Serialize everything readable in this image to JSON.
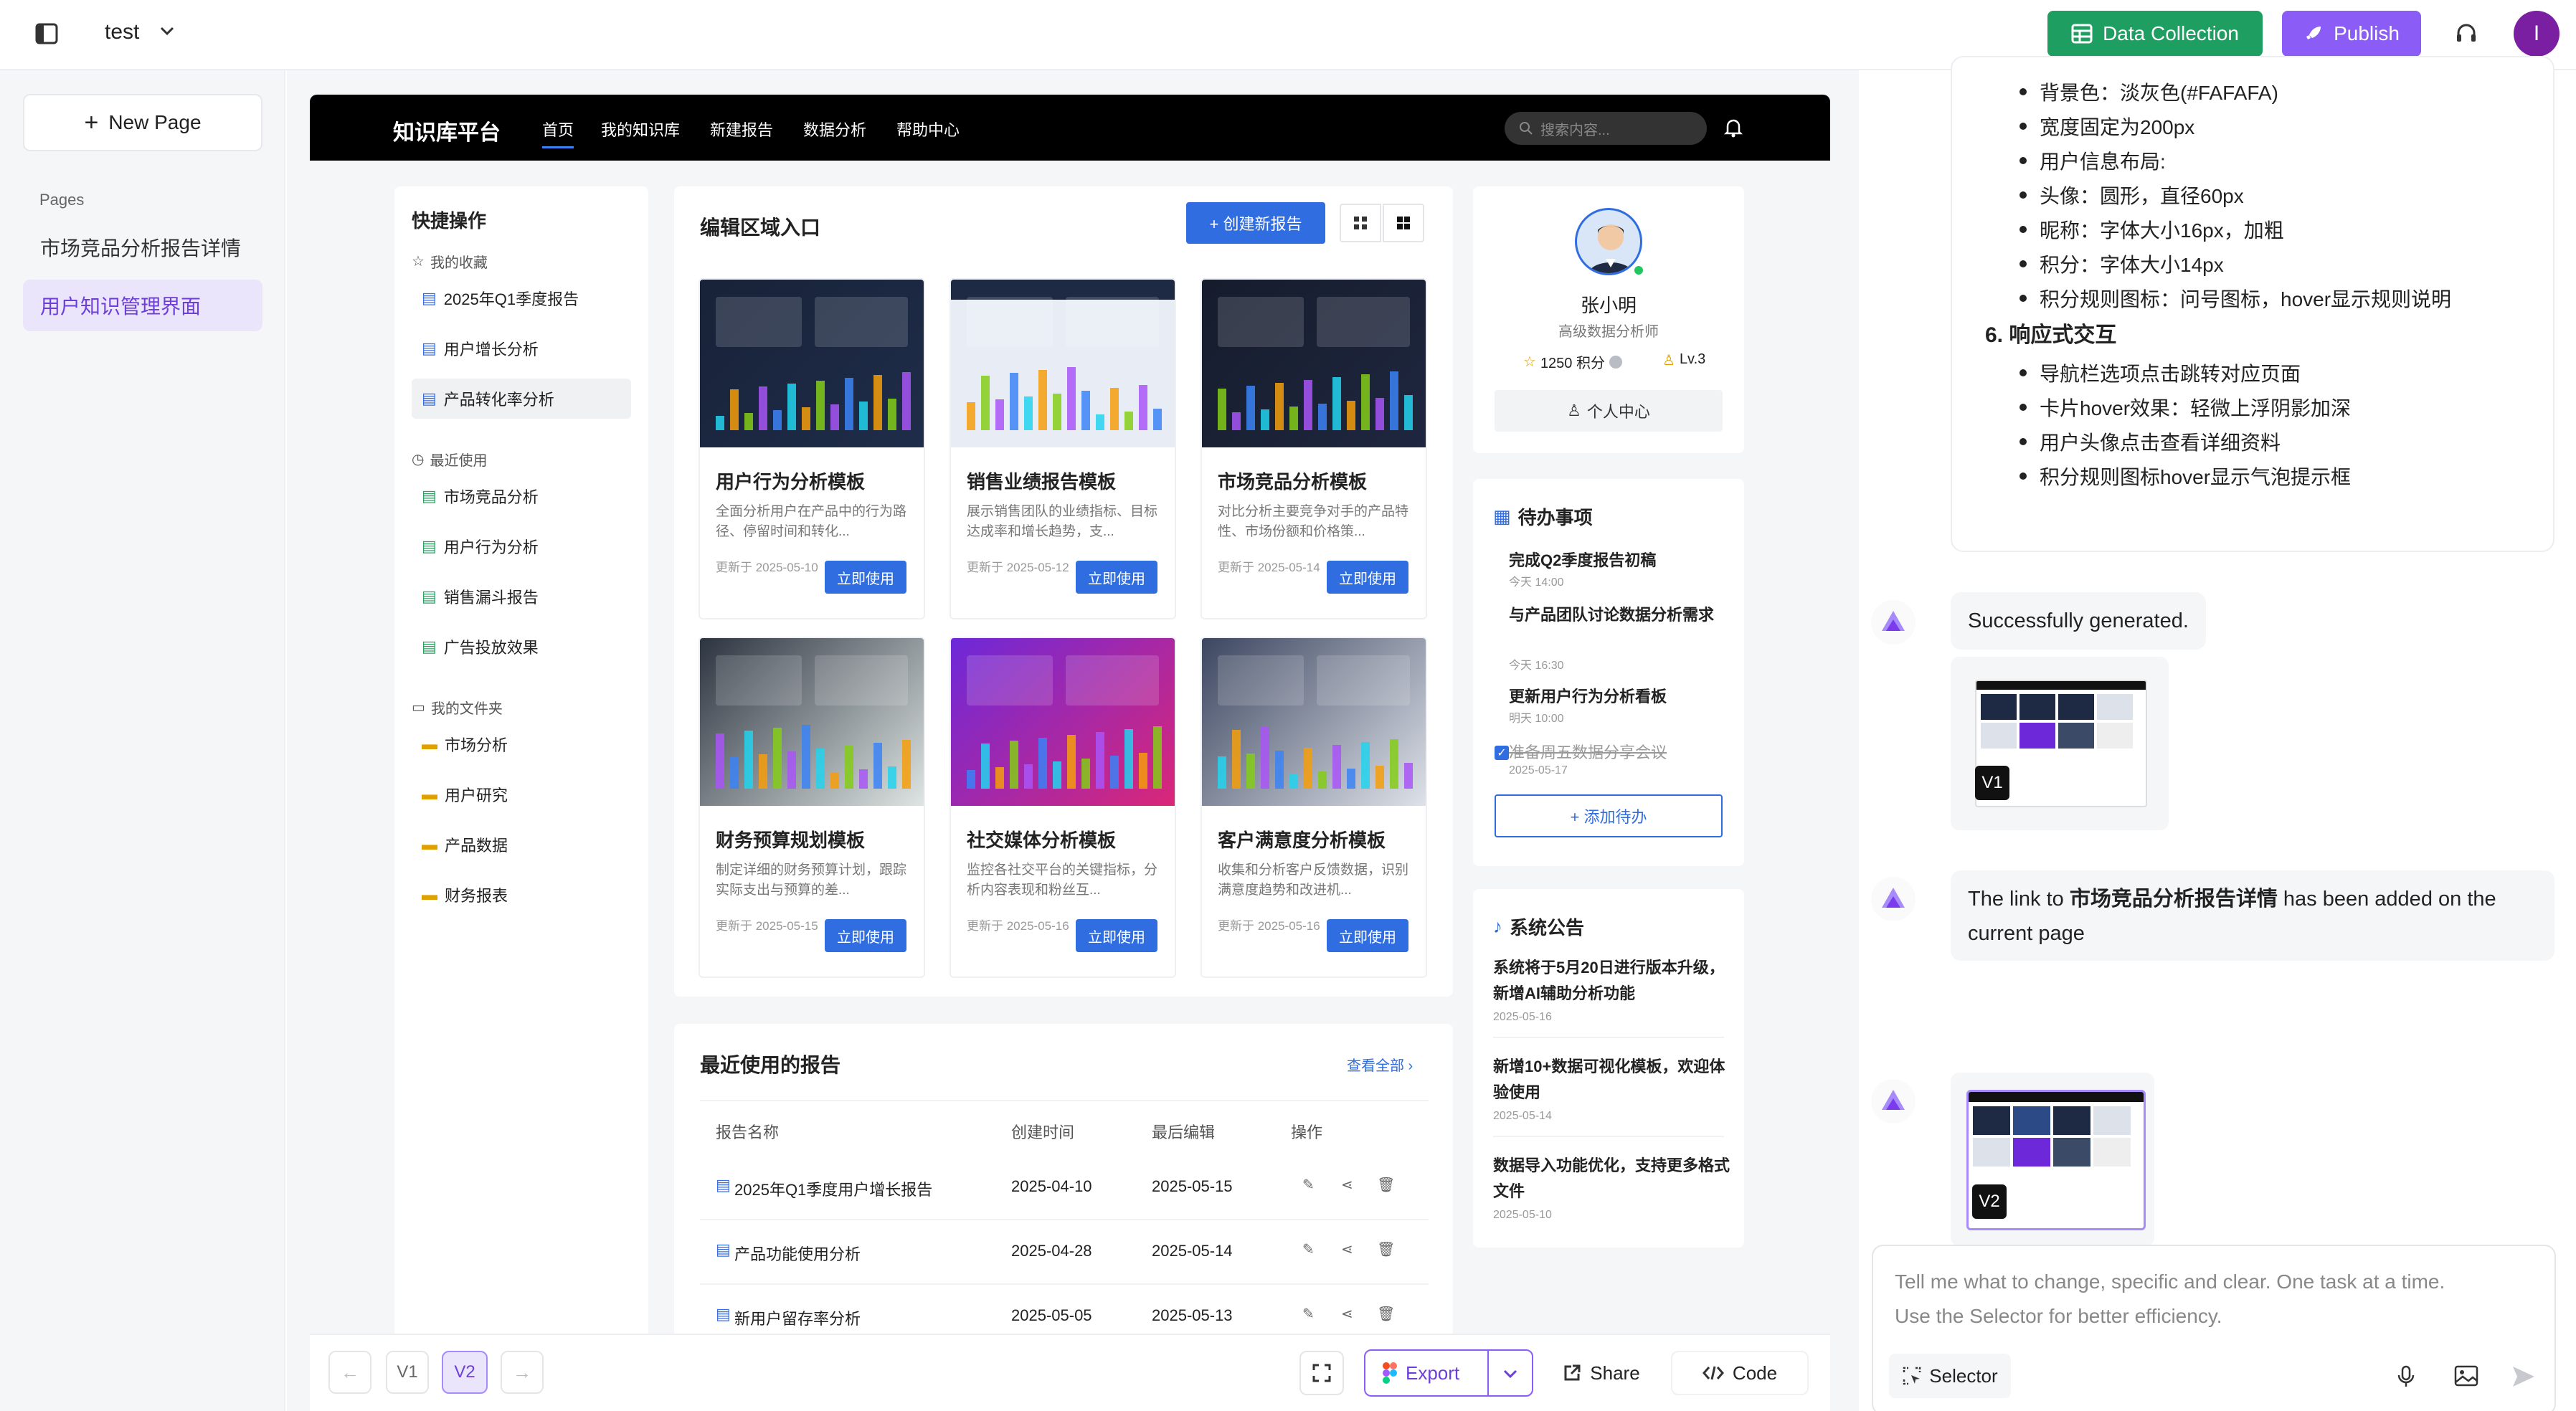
{
  "topbar": {
    "project_name": "test",
    "data_collection_label": "Data Collection",
    "publish_label": "Publish",
    "user_initial": "I"
  },
  "sidebar": {
    "new_page_label": "New Page",
    "pages_heading": "Pages",
    "pages": [
      {
        "label": "市场竞品分析报告详情"
      },
      {
        "label": "用户知识管理界面"
      }
    ]
  },
  "app": {
    "logo": "知识库平台",
    "nav": [
      "首页",
      "我的知识库",
      "新建报告",
      "数据分析",
      "帮助中心"
    ],
    "search_placeholder": "搜索内容...",
    "quick": {
      "title": "快捷操作",
      "fav_label": "我的收藏",
      "favorites": [
        "2025年Q1季度报告",
        "用户增长分析",
        "产品转化率分析"
      ],
      "recent_label": "最近使用",
      "recent": [
        "市场竞品分析",
        "用户行为分析",
        "销售漏斗报告",
        "广告投放效果"
      ],
      "folder_label": "我的文件夹",
      "folders": [
        "市场分析",
        "用户研究",
        "产品数据",
        "财务报表"
      ]
    },
    "editor": {
      "title": "编辑区域入口",
      "create_label": "+ 创建新报告",
      "use_label": "立即使用",
      "templates": [
        {
          "title": "用户行为分析模板",
          "desc": "全面分析用户在产品中的行为路径、停留时间和转化...",
          "date": "更新于 2025-05-10"
        },
        {
          "title": "销售业绩报告模板",
          "desc": "展示销售团队的业绩指标、目标达成率和增长趋势，支...",
          "date": "更新于 2025-05-12"
        },
        {
          "title": "市场竞品分析模板",
          "desc": "对比分析主要竞争对手的产品特性、市场份额和价格策...",
          "date": "更新于 2025-05-14"
        },
        {
          "title": "财务预算规划模板",
          "desc": "制定详细的财务预算计划，跟踪实际支出与预算的差...",
          "date": "更新于 2025-05-15"
        },
        {
          "title": "社交媒体分析模板",
          "desc": "监控各社交平台的关键指标，分析内容表现和粉丝互...",
          "date": "更新于 2025-05-16"
        },
        {
          "title": "客户满意度分析模板",
          "desc": "收集和分析客户反馈数据，识别满意度趋势和改进机...",
          "date": "更新于 2025-05-16"
        }
      ]
    },
    "recent_reports": {
      "title": "最近使用的报告",
      "view_all": "查看全部",
      "columns": [
        "报告名称",
        "创建时间",
        "最后编辑",
        "操作"
      ],
      "rows": [
        {
          "name": "2025年Q1季度用户增长报告",
          "created": "2025-04-10",
          "edited": "2025-05-15"
        },
        {
          "name": "产品功能使用分析",
          "created": "2025-04-28",
          "edited": "2025-05-14"
        },
        {
          "name": "新用户留存率分析",
          "created": "2025-05-05",
          "edited": "2025-05-13"
        }
      ]
    },
    "profile": {
      "name": "张小明",
      "role": "高级数据分析师",
      "points": "1250 积分",
      "level": "Lv.3",
      "center_label": "个人中心"
    },
    "todo": {
      "title": "待办事项",
      "items": [
        {
          "text": "完成Q2季度报告初稿",
          "time": "今天 14:00",
          "done": false
        },
        {
          "text": "与产品团队讨论数据分析需求",
          "time": "今天 16:30",
          "done": false
        },
        {
          "text": "更新用户行为分析看板",
          "time": "明天 10:00",
          "done": false
        },
        {
          "text": "准备周五数据分享会议",
          "time": "2025-05-17",
          "done": true
        }
      ],
      "add_label": "+ 添加待办"
    },
    "notice": {
      "title": "系统公告",
      "items": [
        {
          "text": "系统将于5月20日进行版本升级，新增AI辅助分析功能",
          "date": "2025-05-16"
        },
        {
          "text": "新增10+数据可视化模板，欢迎体验使用",
          "date": "2025-05-14"
        },
        {
          "text": "数据导入功能优化，支持更多格式文件",
          "date": "2025-05-10"
        }
      ]
    }
  },
  "chat": {
    "spec_bullets_a": [
      "背景色：淡灰色(#FAFAFA)",
      "宽度固定为200px",
      "用户信息布局:",
      "头像：圆形，直径60px",
      "昵称：字体大小16px，加粗",
      "积分：字体大小14px",
      "积分规则图标：问号图标，hover显示规则说明"
    ],
    "spec_heading": "6. 响应式交互",
    "spec_bullets_b": [
      "导航栏选项点击跳转对应页面",
      "卡片hover效果：轻微上浮阴影加深",
      "用户头像点击查看详细资料",
      "积分规则图标hover显示气泡提示框"
    ],
    "msg1": "Successfully generated.",
    "v1": "V1",
    "msg2_pre": "The link to ",
    "msg2_link": "市场竞品分析报告详情",
    "msg2_post": " has been added on the current page",
    "v2": "V2",
    "input_placeholder_line1": "Tell me what to change, specific and clear. One task at a time.",
    "input_placeholder_line2": "Use the Selector for better efficiency.",
    "selector_label": "Selector"
  },
  "toolbar": {
    "v1": "V1",
    "v2": "V2",
    "export_label": "Export",
    "share_label": "Share",
    "code_label": "Code"
  },
  "colors": {
    "accent_purple": "#8b5cf6",
    "green": "#1e9e61",
    "blue": "#2f6de1"
  }
}
